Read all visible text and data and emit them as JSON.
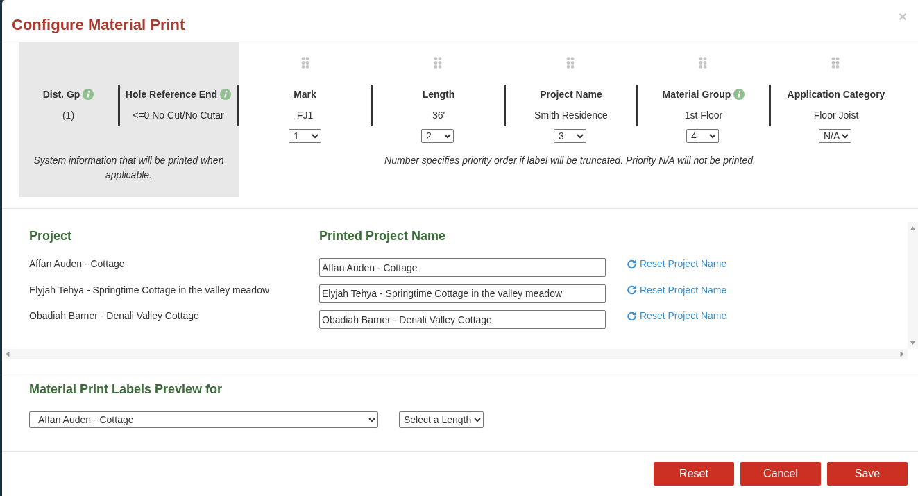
{
  "dialog": {
    "title": "Configure Material Print",
    "close": "×"
  },
  "system_fields": {
    "columns": [
      {
        "heading": "Dist. Gp",
        "info": true,
        "value": "(1)"
      },
      {
        "heading": "Hole Reference End",
        "info": true,
        "value": "<=0 No Cut/No Cutar"
      }
    ],
    "note": "System information that will be printed when applicable."
  },
  "priority_fields": {
    "columns": [
      {
        "heading": "Mark",
        "info": false,
        "value": "FJ1",
        "priority": "1"
      },
      {
        "heading": "Length",
        "info": false,
        "value": "36'",
        "priority": "2"
      },
      {
        "heading": "Project Name",
        "info": false,
        "value": "Smith Residence",
        "priority": "3"
      },
      {
        "heading": "Material Group",
        "info": true,
        "value": "1st Floor",
        "priority": "4"
      },
      {
        "heading": "Application Category",
        "info": false,
        "value": "Floor Joist",
        "priority": "N/A"
      }
    ],
    "note": "Number specifies priority order if label will be truncated. Priority N/A will not be printed."
  },
  "projects": {
    "headings": [
      "Project",
      "Printed Project Name"
    ],
    "rows": [
      {
        "project": "Affan Auden - Cottage",
        "printed_name": "Affan Auden - Cottage",
        "reset_link": "Reset Project Name"
      },
      {
        "project": "Elyjah Tehya - Springtime Cottage in the valley meadow",
        "printed_name": "Elyjah Tehya - Springtime Cottage in the valley meadow",
        "reset_link": "Reset Project Name"
      },
      {
        "project": "Obadiah Barner - Denali Valley Cottage",
        "printed_name": "Obadiah Barner - Denali Valley Cottage",
        "reset_link": "Reset Project Name"
      }
    ]
  },
  "preview": {
    "heading": "Material Print Labels Preview for",
    "project_select": "Affan Auden - Cottage",
    "length_select": "Select a Length"
  },
  "buttons": [
    "Reset",
    "Cancel",
    "Save"
  ]
}
